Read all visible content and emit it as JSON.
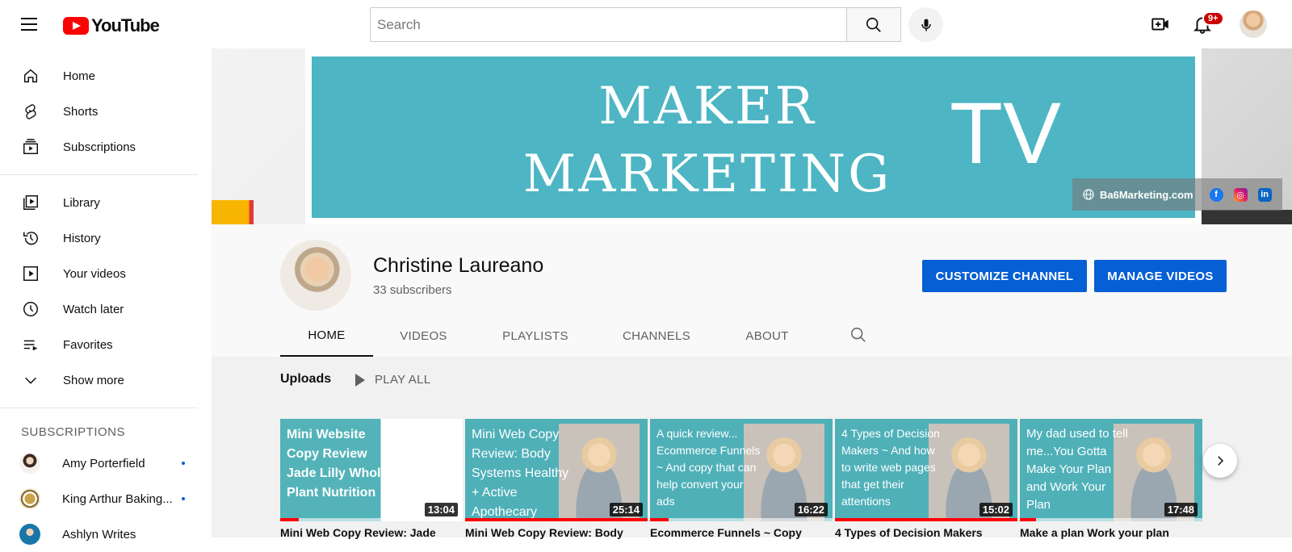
{
  "brand": {
    "logo_text": "YouTube"
  },
  "search": {
    "placeholder": "Search"
  },
  "notifications": {
    "badge": "9+"
  },
  "sidebar": {
    "items": [
      {
        "label": "Home",
        "icon": "home-icon"
      },
      {
        "label": "Shorts",
        "icon": "shorts-icon"
      },
      {
        "label": "Subscriptions",
        "icon": "subscriptions-icon"
      },
      {
        "label": "Library",
        "icon": "library-icon"
      },
      {
        "label": "History",
        "icon": "history-icon"
      },
      {
        "label": "Your videos",
        "icon": "your-videos-icon"
      },
      {
        "label": "Watch later",
        "icon": "clock-icon"
      },
      {
        "label": "Favorites",
        "icon": "playlist-icon"
      },
      {
        "label": "Show more",
        "icon": "chevron-down-icon"
      }
    ],
    "subscriptions_heading": "SUBSCRIPTIONS",
    "subscriptions": [
      {
        "name": "Amy Porterfield"
      },
      {
        "name": "King Arthur Baking..."
      },
      {
        "name": "Ashlyn Writes"
      }
    ]
  },
  "banner": {
    "title_line1": "MAKER",
    "title_line2": "MARKETING",
    "tv": "TV",
    "link_text": "Ba6Marketing.com"
  },
  "channel": {
    "name": "Christine Laureano",
    "subscribers": "33 subscribers",
    "customize_label": "CUSTOMIZE CHANNEL",
    "manage_label": "MANAGE VIDEOS"
  },
  "tabs": [
    "HOME",
    "VIDEOS",
    "PLAYLISTS",
    "CHANNELS",
    "ABOUT"
  ],
  "uploads": {
    "title": "Uploads",
    "play_all": "PLAY ALL",
    "videos": [
      {
        "thumb_text": "Mini Website Copy Review Jade Lilly Whole Plant Nutrition",
        "duration": "13:04",
        "title": "Mini Web Copy Review: Jade",
        "progress": 0.1
      },
      {
        "thumb_text": "Mini Web Copy Review: Body Systems Healthy + Active Apothecary",
        "duration": "25:14",
        "title": "Mini Web Copy Review: Body",
        "progress": 1.0
      },
      {
        "thumb_text": "A quick review... Ecommerce Funnels ~ And copy that can help convert your ads",
        "duration": "16:22",
        "title": "Ecommerce Funnels ~ Copy",
        "progress": 0.1
      },
      {
        "thumb_text": "4 Types of Decision Makers ~ And how to write web pages that get their attentions",
        "duration": "15:02",
        "title": "4 Types of Decision Makers",
        "progress": 1.0
      },
      {
        "thumb_text": "My dad used to tell me...You Gotta Make Your Plan and Work Your Plan",
        "duration": "17:48",
        "title": "Make a plan Work your plan",
        "progress": 0.09
      }
    ]
  }
}
